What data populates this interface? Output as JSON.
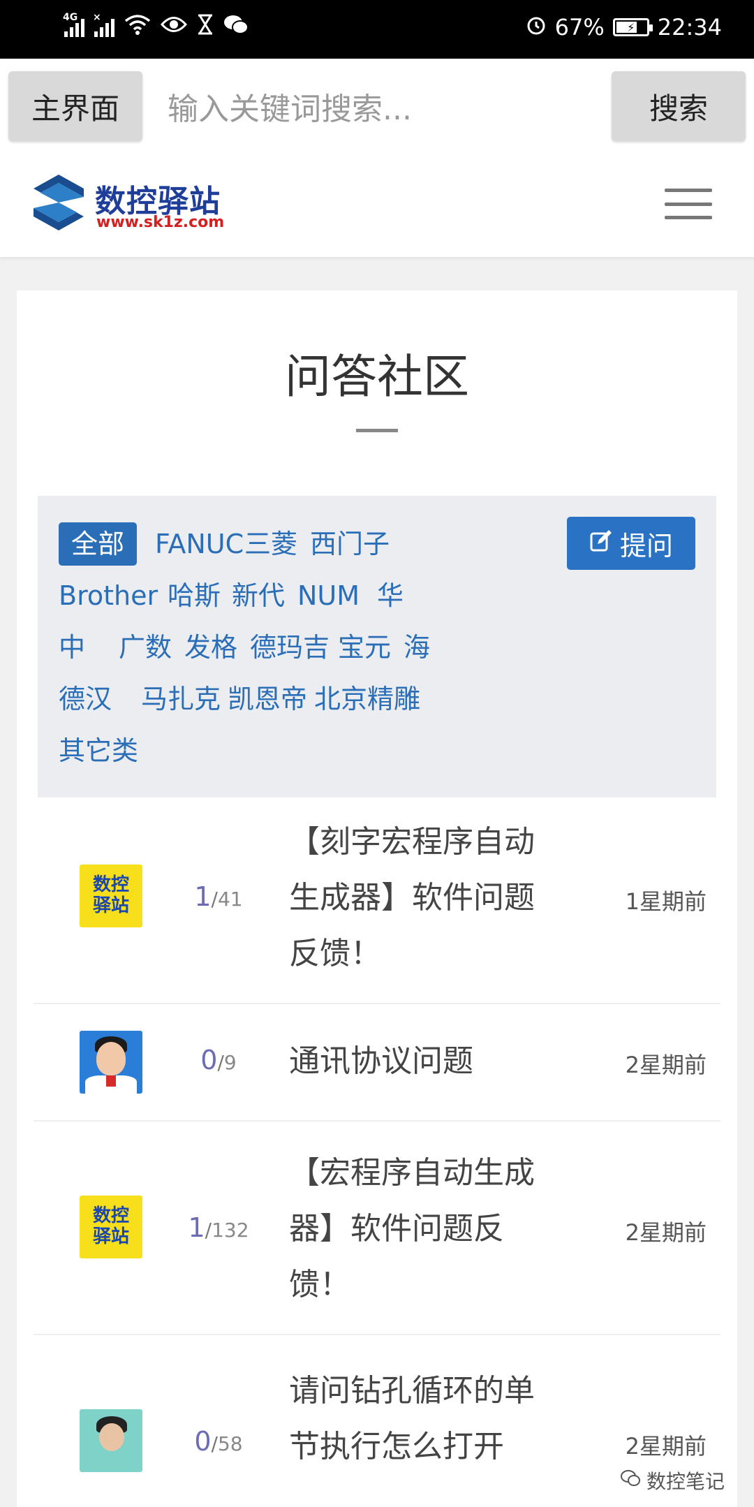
{
  "status_bar": {
    "network_tag": "4G",
    "battery": "67%",
    "battery_level": 0.67,
    "time": "22:34"
  },
  "search_bar": {
    "home_label": "主界面",
    "placeholder": "输入关键词搜索...",
    "search_label": "搜索"
  },
  "header": {
    "logo_title": "数控驿站",
    "logo_url": "www.sk1z.com",
    "brand_color": "#1f3e9a",
    "accent_color": "#d32020"
  },
  "page": {
    "title": "问答社区"
  },
  "filters": {
    "ask_label": "提问",
    "tags": [
      "全部",
      "FANUC",
      "三菱",
      "西门子",
      "Brother",
      "哈斯",
      "新代",
      "NUM",
      "华",
      "中",
      "广数",
      "发格",
      "德玛吉",
      "宝元",
      "海",
      "德汉",
      "马扎克",
      "凯恩帝",
      "北京精雕",
      "其它类"
    ],
    "active_tag": "全部"
  },
  "questions": [
    {
      "avatar": "logo",
      "avatar_text": [
        "数控",
        "驿站"
      ],
      "answers": "1",
      "views": "41",
      "title_lines": [
        "【刻字宏程序自动",
        "生成器】软件问题",
        "反馈！"
      ],
      "time": "1星期前"
    },
    {
      "avatar": "photo",
      "answers": "0",
      "views": "9",
      "title_lines": [
        "通讯协议问题"
      ],
      "time": "2星期前"
    },
    {
      "avatar": "logo",
      "avatar_text": [
        "数控",
        "驿站"
      ],
      "answers": "1",
      "views": "132",
      "title_lines": [
        "【宏程序自动生成",
        "器】软件问题反",
        "馈！"
      ],
      "time": "2星期前"
    },
    {
      "avatar": "photo",
      "answers": "0",
      "views": "58",
      "title_lines": [
        "请问钻孔循环的单",
        "节执行怎么打开"
      ],
      "time": "2星期前"
    }
  ],
  "watermark": {
    "text": "数控笔记"
  }
}
